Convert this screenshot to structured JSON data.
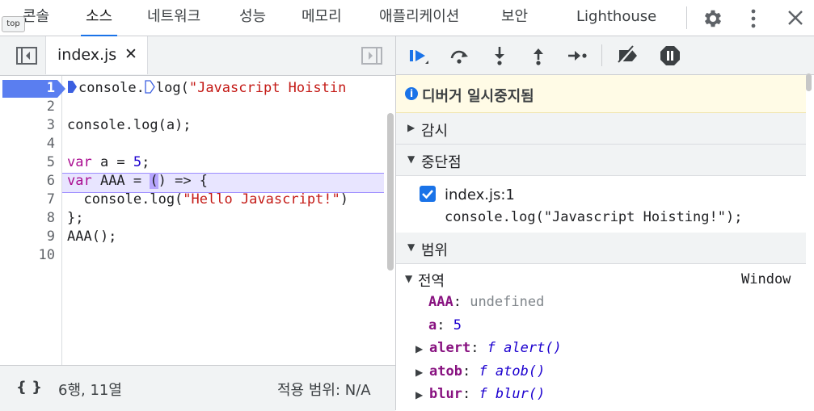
{
  "top_tabs": [
    "콘솔",
    "소스",
    "네트워크",
    "성능",
    "메모리",
    "애플리케이션",
    "보안",
    "Lighthouse"
  ],
  "active_tab": "소스",
  "tooltip": "top",
  "icons": {
    "settings": "gear-icon",
    "more": "kebab-menu-icon",
    "close": "close-icon",
    "toggle_navigator": "sidebar-toggle-icon",
    "toggle_debugger": "panel-toggle-icon"
  },
  "editor": {
    "filename": "index.js",
    "close_glyph": "✕",
    "active_line": 1,
    "line_numbers": [
      "1",
      "2",
      "3",
      "4",
      "5",
      "6",
      "7",
      "8",
      "9",
      "10"
    ],
    "lines": [
      {
        "parts": [
          {
            "t": "console.",
            "c": ""
          },
          {
            "t": "log(",
            "c": ""
          },
          {
            "t": "\"Javascript Hoistin",
            "c": "str"
          }
        ]
      },
      {
        "parts": []
      },
      {
        "parts": [
          {
            "t": "console.log(a);",
            "c": ""
          }
        ]
      },
      {
        "parts": []
      },
      {
        "parts": [
          {
            "t": "var",
            "c": "kw"
          },
          {
            "t": " a = ",
            "c": ""
          },
          {
            "t": "5",
            "c": "num"
          },
          {
            "t": ";",
            "c": ""
          }
        ]
      },
      {
        "parts": [
          {
            "t": "var",
            "c": "kw"
          },
          {
            "t": " AAA = ",
            "c": ""
          },
          {
            "t": "(",
            "c": ""
          },
          {
            "t": ") => {",
            "c": ""
          }
        ]
      },
      {
        "parts": [
          {
            "t": "  console.log(",
            "c": ""
          },
          {
            "t": "\"Hello Javascript!\"",
            "c": "str"
          },
          {
            "t": ")",
            "c": ""
          }
        ]
      },
      {
        "parts": [
          {
            "t": "};",
            "c": ""
          }
        ]
      },
      {
        "parts": [
          {
            "t": "AAA();",
            "c": ""
          }
        ]
      },
      {
        "parts": []
      }
    ]
  },
  "status_bar": {
    "braces": "{ }",
    "position": "6행, 11열",
    "coverage": "적용 범위: N/A"
  },
  "debugger": {
    "paused_text": "디버거 일시중지됨",
    "info_glyph": "i",
    "watch": "감시",
    "breakpoints": "중단점",
    "breakpoint_file": "index.js:1",
    "breakpoint_code": "console.log(\"Javascript Hoisting!\");",
    "scope": "범위",
    "global": "전역",
    "global_value": "Window",
    "vars": [
      {
        "name": "AAA",
        "sep": ": ",
        "value": "undefined",
        "kind": "undef",
        "expand": false
      },
      {
        "name": "a",
        "sep": ": ",
        "value": "5",
        "kind": "num",
        "expand": false
      },
      {
        "name": "alert",
        "sep": ": ",
        "value": "f alert()",
        "kind": "fn",
        "expand": true
      },
      {
        "name": "atob",
        "sep": ": ",
        "value": "f atob()",
        "kind": "fn",
        "expand": true
      },
      {
        "name": "blur",
        "sep": ": ",
        "value": "f blur()",
        "kind": "fn",
        "expand": true
      }
    ]
  },
  "colors": {
    "accent": "#1a73e8",
    "paused_bg": "#fffbe6",
    "line_highlight": "#e8e5ff",
    "active_line": "#5a7ef0"
  }
}
